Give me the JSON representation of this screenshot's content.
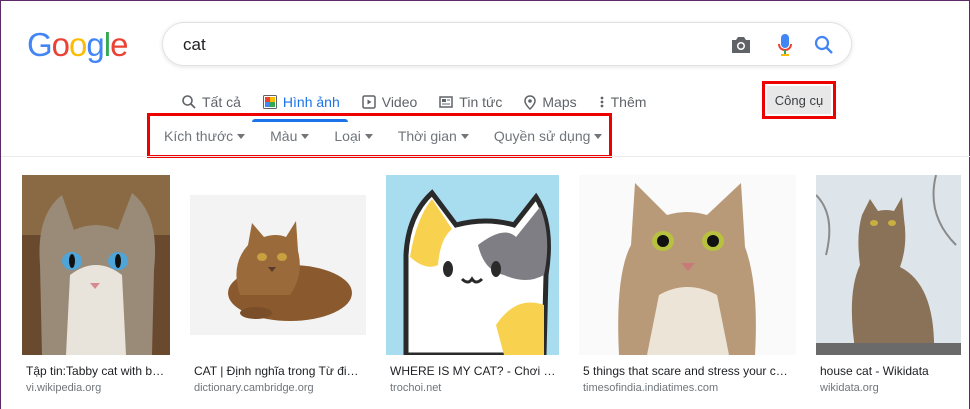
{
  "logo": {
    "letters": [
      "G",
      "o",
      "o",
      "g",
      "l",
      "e"
    ],
    "colors": [
      "#4285f4",
      "#ea4335",
      "#fbbc05",
      "#4285f4",
      "#34a853",
      "#ea4335"
    ]
  },
  "search": {
    "value": "cat"
  },
  "tabs": [
    {
      "label": "Tất cả",
      "icon": "search-icon"
    },
    {
      "label": "Hình ảnh",
      "icon": "image-icon",
      "active": true
    },
    {
      "label": "Video",
      "icon": "video-icon"
    },
    {
      "label": "Tin tức",
      "icon": "news-icon"
    },
    {
      "label": "Maps",
      "icon": "map-pin-icon"
    },
    {
      "label": "Thêm",
      "icon": "more-vert-icon"
    }
  ],
  "tools": {
    "label": "Công cụ"
  },
  "filters": [
    "Kích thước",
    "Màu",
    "Loại",
    "Thời gian",
    "Quyền sử dụng"
  ],
  "results": [
    {
      "caption": "Tập tin:Tabby cat with b…",
      "source": "vi.wikipedia.org"
    },
    {
      "caption": "CAT | Định nghĩa trong Từ đi…",
      "source": "dictionary.cambridge.org"
    },
    {
      "caption": "WHERE IS MY CAT? - Chơi W…",
      "source": "trochoi.net"
    },
    {
      "caption": "5 things that scare and stress your c…",
      "source": "timesofindia.indiatimes.com"
    },
    {
      "caption": "house cat - Wikidata",
      "source": "wikidata.org"
    }
  ],
  "colors": {
    "accent": "#1a73e8",
    "highlight": "#e00000"
  }
}
